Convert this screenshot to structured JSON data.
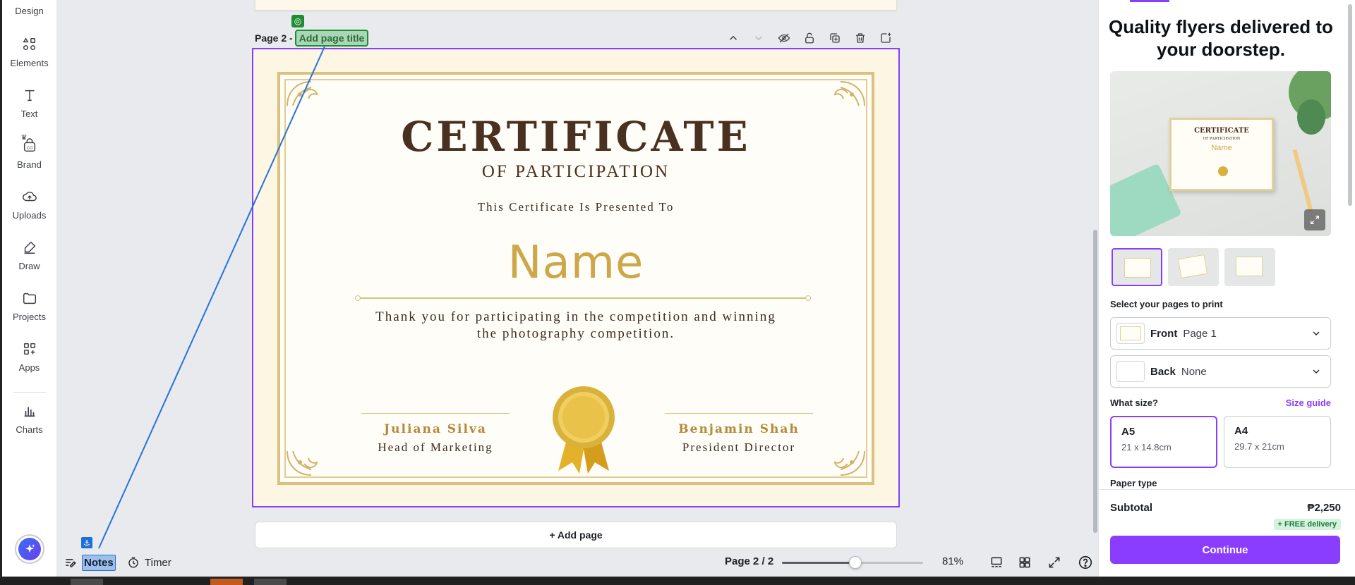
{
  "left_rail": {
    "top_label": "Design",
    "items": [
      {
        "label": "Elements",
        "icon": "elements-icon"
      },
      {
        "label": "Text",
        "icon": "text-icon"
      },
      {
        "label": "Brand",
        "icon": "brand-icon"
      },
      {
        "label": "Uploads",
        "icon": "uploads-icon"
      },
      {
        "label": "Draw",
        "icon": "draw-icon"
      },
      {
        "label": "Projects",
        "icon": "projects-icon"
      },
      {
        "label": "Apps",
        "icon": "apps-icon"
      },
      {
        "label": "Charts",
        "icon": "charts-icon"
      }
    ]
  },
  "canvas": {
    "page_label": "Page 2 -",
    "page_title_placeholder": "Add page title",
    "add_page_label": "+ Add page",
    "toolbar_icons": [
      "chevron-up-icon",
      "chevron-down-icon",
      "hide-icon",
      "lock-icon",
      "duplicate-icon",
      "trash-icon",
      "add-page-icon"
    ]
  },
  "certificate": {
    "title": "CERTIFICATE",
    "subtitle": "OF PARTICIPATION",
    "presented": "This Certificate Is Presented To",
    "name": "Name",
    "body": "Thank you for participating in the competition and winning the photography competition.",
    "signer_left": {
      "name": "Juliana Silva",
      "role": "Head of Marketing"
    },
    "signer_right": {
      "name": "Benjamin Shah",
      "role": "President Director"
    },
    "colors": {
      "title": "#4a3020",
      "gold": "#cda84a",
      "border": "#dcc07f"
    }
  },
  "bottom_bar": {
    "notes_label": "Notes",
    "timer_label": "Timer",
    "page_indicator": "Page 2 / 2",
    "zoom_value": "81%",
    "zoom_fraction": 0.52
  },
  "right_panel": {
    "headline": "Quality flyers delivered to your doorstep.",
    "hero_cert_title": "CERTIFICATE",
    "hero_cert_sub": "OF PARTICIPATION",
    "hero_cert_name": "Name",
    "select_pages_label": "Select your pages to print",
    "front": {
      "key": "Front",
      "value": "Page 1"
    },
    "back": {
      "key": "Back",
      "value": "None"
    },
    "size_label": "What size?",
    "size_guide": "Size guide",
    "sizes": [
      {
        "name": "A5",
        "dims": "21 x 14.8cm",
        "selected": true
      },
      {
        "name": "A4",
        "dims": "29.7 x 21cm",
        "selected": false
      }
    ],
    "paper_type_label": "Paper type",
    "subtotal_label": "Subtotal",
    "subtotal_value": "₱2,250",
    "free_delivery": "+ FREE delivery",
    "continue_label": "Continue",
    "accent": "#8b3dff"
  }
}
